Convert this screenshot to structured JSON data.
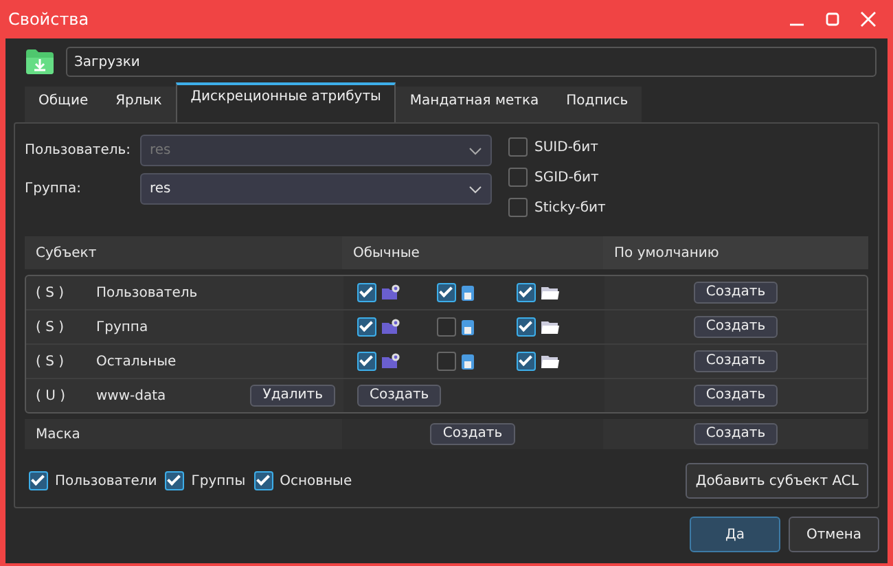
{
  "window": {
    "title": "Свойства"
  },
  "file": {
    "name": "Загрузки"
  },
  "tabs": [
    {
      "label": "Общие",
      "selected": false
    },
    {
      "label": "Ярлык",
      "selected": false
    },
    {
      "label": "Дискреционные атрибуты",
      "selected": true
    },
    {
      "label": "Мандатная метка",
      "selected": false
    },
    {
      "label": "Подпись",
      "selected": false
    }
  ],
  "owner": {
    "user_label": "Пользователь:",
    "user_value": "res",
    "user_disabled": true,
    "group_label": "Группа:",
    "group_value": "res",
    "group_disabled": false
  },
  "special_bits": [
    {
      "label": "SUID-бит",
      "checked": false
    },
    {
      "label": "SGID-бит",
      "checked": false
    },
    {
      "label": "Sticky-бит",
      "checked": false
    }
  ],
  "acl_table": {
    "columns": [
      "Субъект",
      "Обычные",
      "По умолчанию"
    ],
    "rows": [
      {
        "tag": "( S )",
        "name": "Пользователь",
        "permissions": [
          {
            "kind": "read",
            "checked": true
          },
          {
            "kind": "write",
            "checked": true
          },
          {
            "kind": "execute",
            "checked": true
          }
        ],
        "default_action": "Создать"
      },
      {
        "tag": "( S )",
        "name": "Группа",
        "permissions": [
          {
            "kind": "read",
            "checked": true
          },
          {
            "kind": "write",
            "checked": false
          },
          {
            "kind": "execute",
            "checked": true
          }
        ],
        "default_action": "Создать"
      },
      {
        "tag": "( S )",
        "name": "Остальные",
        "permissions": [
          {
            "kind": "read",
            "checked": true
          },
          {
            "kind": "write",
            "checked": false
          },
          {
            "kind": "execute",
            "checked": true
          }
        ],
        "default_action": "Создать"
      },
      {
        "tag": "( U )",
        "name": "www-data",
        "delete_action": "Удалить",
        "normal_action": "Создать",
        "default_action": "Создать"
      }
    ],
    "mask": {
      "label": "Маска",
      "normal_action": "Создать",
      "default_action": "Создать"
    }
  },
  "filters": [
    {
      "label": "Пользователи",
      "checked": true
    },
    {
      "label": "Группы",
      "checked": true
    },
    {
      "label": "Основные",
      "checked": true
    }
  ],
  "add_button": "Добавить субъект ACL",
  "buttons": [
    {
      "label": "Да",
      "kind": "primary"
    },
    {
      "label": "Отмена",
      "kind": "normal"
    }
  ]
}
